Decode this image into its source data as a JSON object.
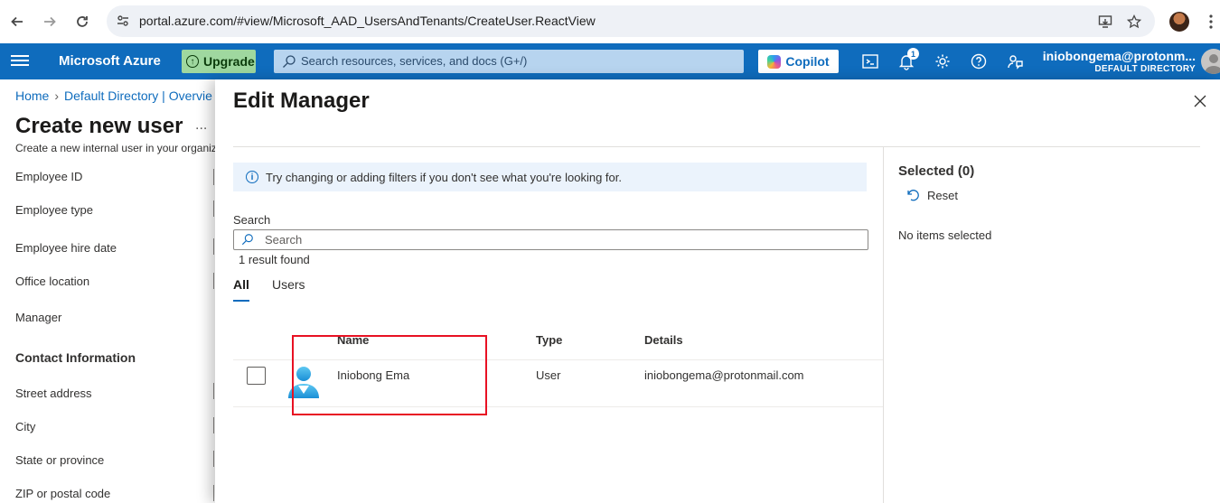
{
  "browser": {
    "url": "portal.azure.com/#view/Microsoft_AAD_UsersAndTenants/CreateUser.ReactView"
  },
  "topbar": {
    "brand": "Microsoft Azure",
    "upgrade_label": "Upgrade",
    "search_placeholder": "Search resources, services, and docs (G+/)",
    "copilot_label": "Copilot",
    "notifications_count": "1",
    "account_email": "iniobongema@protonm...",
    "account_directory": "DEFAULT DIRECTORY",
    "accent_color": "#0f6cbd"
  },
  "background_page": {
    "breadcrumb": [
      "Home",
      "Default Directory | Overvie"
    ],
    "title": "Create new user",
    "more": "...",
    "subtitle": "Create a new internal user in your organiz",
    "fields_top": [
      "Employee ID",
      "Employee type",
      "Employee hire date",
      "Office location",
      "Manager"
    ],
    "section_contact": "Contact Information",
    "fields_contact": [
      "Street address",
      "City",
      "State or province",
      "ZIP or postal code"
    ]
  },
  "panel": {
    "title": "Edit Manager",
    "info_text": "Try changing or adding filters if you don't see what you're looking for.",
    "search_label": "Search",
    "search_placeholder": "Search",
    "result_count": "1 result found",
    "tabs": [
      "All",
      "Users"
    ],
    "columns": [
      "Name",
      "Type",
      "Details"
    ],
    "rows": [
      {
        "name": "Iniobong Ema",
        "type": "User",
        "details": "iniobongema@protonmail.com"
      }
    ],
    "selected_title": "Selected (0)",
    "reset_label": "Reset",
    "no_items": "No items selected",
    "highlight_color": "#e81123"
  }
}
